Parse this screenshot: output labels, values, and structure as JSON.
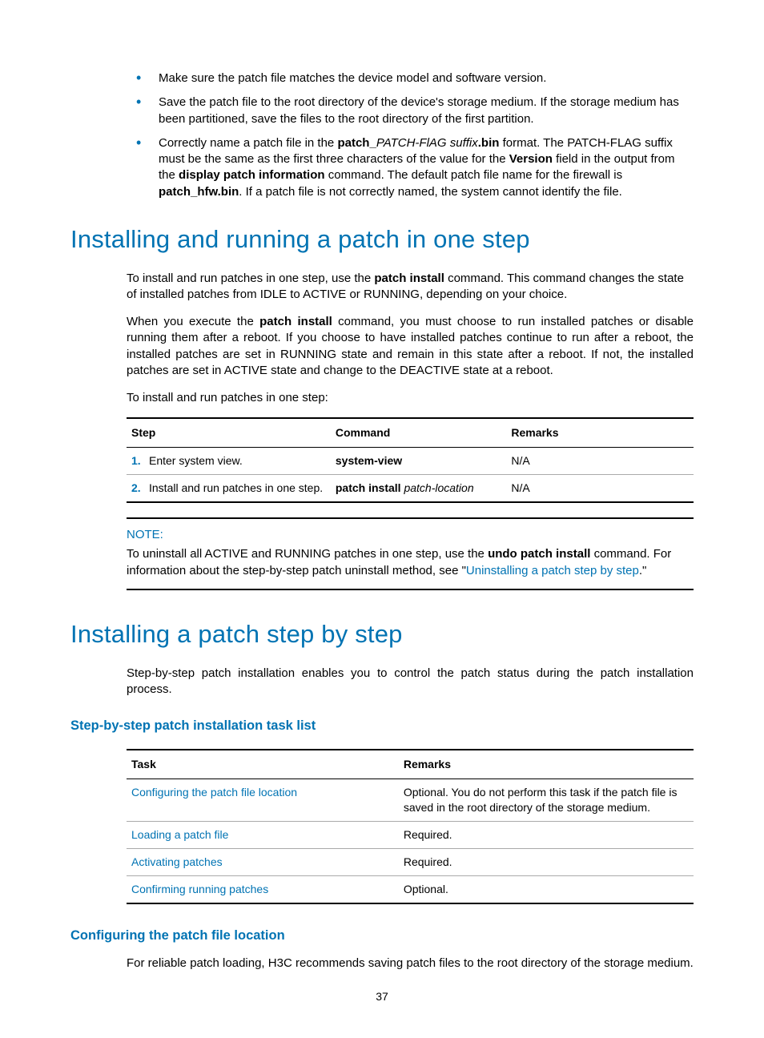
{
  "bullets": [
    {
      "text": "Make sure the patch file matches the device model and software version."
    },
    {
      "text": "Save the patch file to the root directory of the device's storage medium. If the storage medium has been partitioned, save the files to the root directory of the first partition."
    },
    {
      "pre": "Correctly name a patch file in the ",
      "b1": "patch_",
      "i1": "PATCH-FlAG suffix",
      "b2": ".bin",
      "mid1": " format. The PATCH-FLAG suffix must be the same as the first three characters of the value for the ",
      "b3": "Version",
      "mid2": " field in the output from the ",
      "b4": "display patch information",
      "mid3": " command. The default patch file name for the firewall is ",
      "b5": "patch_hfw.bin",
      "post": ". If a patch file is not correctly named, the system cannot identify the file."
    }
  ],
  "section1": {
    "title": "Installing and running a patch in one step",
    "p1a": "To install and run patches in one step, use the ",
    "p1b": "patch install",
    "p1c": " command. This command changes the state of installed patches from IDLE to ACTIVE or RUNNING, depending on your choice.",
    "p2a": "When you execute the ",
    "p2b": "patch install",
    "p2c": " command, you must choose to run installed patches or disable running them after a reboot. If you choose to have installed patches continue to run after a reboot, the installed patches are set in RUNNING state and remain in this state after a reboot. If not, the installed patches are set in ACTIVE state and change to the DEACTIVE state at a reboot.",
    "p3": "To install and run patches in one step:"
  },
  "cmdtable": {
    "headers": {
      "step": "Step",
      "command": "Command",
      "remarks": "Remarks"
    },
    "rows": [
      {
        "num": "1.",
        "step": "Enter system view.",
        "cmd": "system-view",
        "arg": "",
        "remarks": "N/A"
      },
      {
        "num": "2.",
        "step": "Install and run patches in one step.",
        "cmd": "patch install",
        "arg": " patch-location",
        "remarks": "N/A"
      }
    ]
  },
  "note": {
    "label": "NOTE:",
    "pre": "To uninstall all ACTIVE and RUNNING patches in one step, use the ",
    "b": "undo patch install",
    "mid": " command. For information about the step-by-step patch uninstall method, see \"",
    "link": "Uninstalling a patch step by step",
    "post": ".\""
  },
  "section2": {
    "title": "Installing a patch step by step",
    "p1": "Step-by-step patch installation enables you to control the patch status during the patch installation process.",
    "sub1": "Step-by-step patch installation task list"
  },
  "tasktable": {
    "headers": {
      "task": "Task",
      "remarks": "Remarks"
    },
    "rows": [
      {
        "task": "Configuring the patch file location",
        "remarks": "Optional. You do not perform this task if the patch file is saved in the root directory of the storage medium."
      },
      {
        "task": "Loading a patch file",
        "remarks": "Required."
      },
      {
        "task": "Activating patches",
        "remarks": "Required."
      },
      {
        "task": "Confirming running patches",
        "remarks": "Optional."
      }
    ]
  },
  "section3": {
    "sub": "Configuring the patch file location",
    "p": "For reliable patch loading, H3C recommends saving patch files to the root directory of the storage medium."
  },
  "pageNumber": "37"
}
